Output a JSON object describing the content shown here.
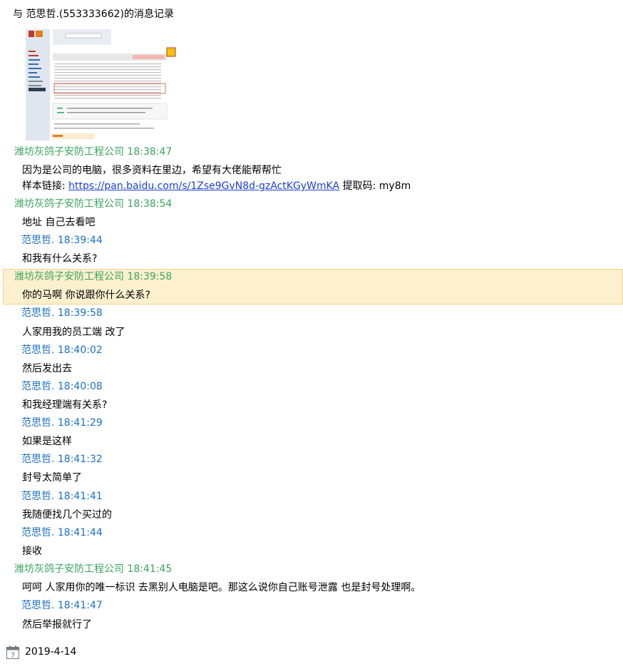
{
  "header": {
    "title": "与  范思哲.(553333662)的消息记录"
  },
  "colors": {
    "other_sender": "#3aa35e",
    "self_sender": "#1c6fc4",
    "highlight_bg": "#fcf0cf",
    "link": "#1a3fd6"
  },
  "messages": [
    {
      "sender": "潍坊灰鸽子安防工程公司 18:38:47",
      "role": "other",
      "lines": [
        "因为是公司的电脑，很多资料在里边，希望有大佬能帮帮忙"
      ],
      "link_prefix": "样本链接: ",
      "link_text": "https://pan.baidu.com/s/1Zse9GvN8d-gzActKGyWmKA",
      "link_suffix": " 提取码: my8m"
    },
    {
      "sender": "潍坊灰鸽子安防工程公司 18:38:54",
      "role": "other",
      "lines": [
        "地址 自己去看吧"
      ]
    },
    {
      "sender": "范思哲. 18:39:44",
      "role": "self",
      "lines": [
        "和我有什么关系?"
      ]
    },
    {
      "sender": "潍坊灰鸽子安防工程公司 18:39:58",
      "role": "other",
      "lines": [
        "你的马啊 你说跟你什么关系?"
      ],
      "highlighted": true
    },
    {
      "sender": "范思哲. 18:39:58",
      "role": "self",
      "lines": [
        "人家用我的员工端 改了"
      ]
    },
    {
      "sender": "范思哲. 18:40:02",
      "role": "self",
      "lines": [
        "然后发出去"
      ]
    },
    {
      "sender": "范思哲. 18:40:08",
      "role": "self",
      "lines": [
        "和我经理端有关系?"
      ]
    },
    {
      "sender": "范思哲. 18:41:29",
      "role": "self",
      "lines": [
        "如果是这样"
      ]
    },
    {
      "sender": "范思哲. 18:41:32",
      "role": "self",
      "lines": [
        "封号太简单了"
      ]
    },
    {
      "sender": "范思哲. 18:41:41",
      "role": "self",
      "lines": [
        "我随便找几个买过的"
      ]
    },
    {
      "sender": "范思哲. 18:41:44",
      "role": "self",
      "lines": [
        "接收"
      ]
    },
    {
      "sender": "潍坊灰鸽子安防工程公司 18:41:45",
      "role": "other",
      "lines": [
        "呵呵 人家用你的唯一标识 去黑别人电脑是吧。那这么说你自己账号泄露 也是封号处理啊。"
      ]
    },
    {
      "sender": "范思哲. 18:41:47",
      "role": "self",
      "lines": [
        "然后举报就行了"
      ]
    }
  ],
  "footer": {
    "date": "2019-4-14",
    "icon": "calendar-icon",
    "icon_day": "7"
  }
}
